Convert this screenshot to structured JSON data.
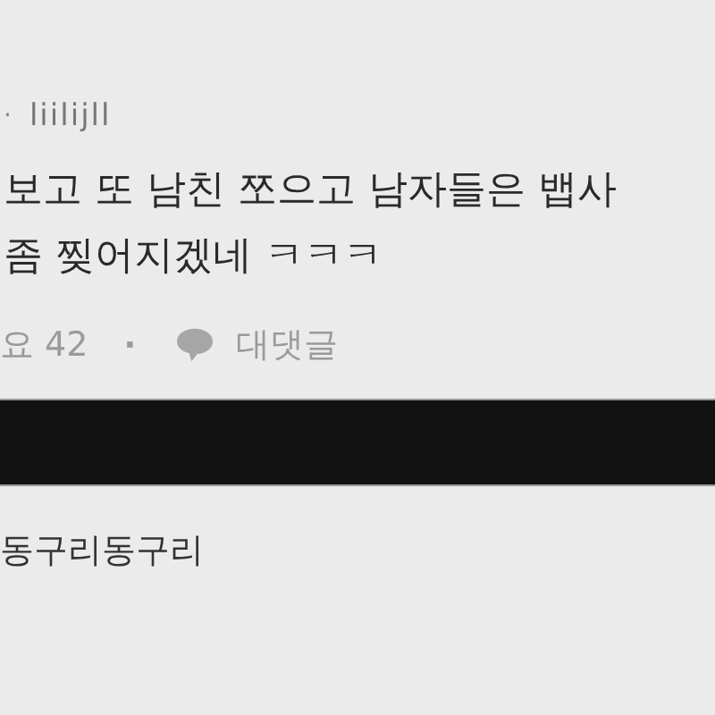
{
  "comment": {
    "author_separator": "·",
    "author": "liilijll",
    "lines": [
      "보고 또 남친 쪼으고 남자들은 뱁사",
      "좀 찢어지겠네 ㅋㅋㅋ"
    ],
    "likes": "요 42",
    "separator": "·",
    "reply_label": "대댓글"
  },
  "next_comment": {
    "author": "동구리동구리"
  }
}
